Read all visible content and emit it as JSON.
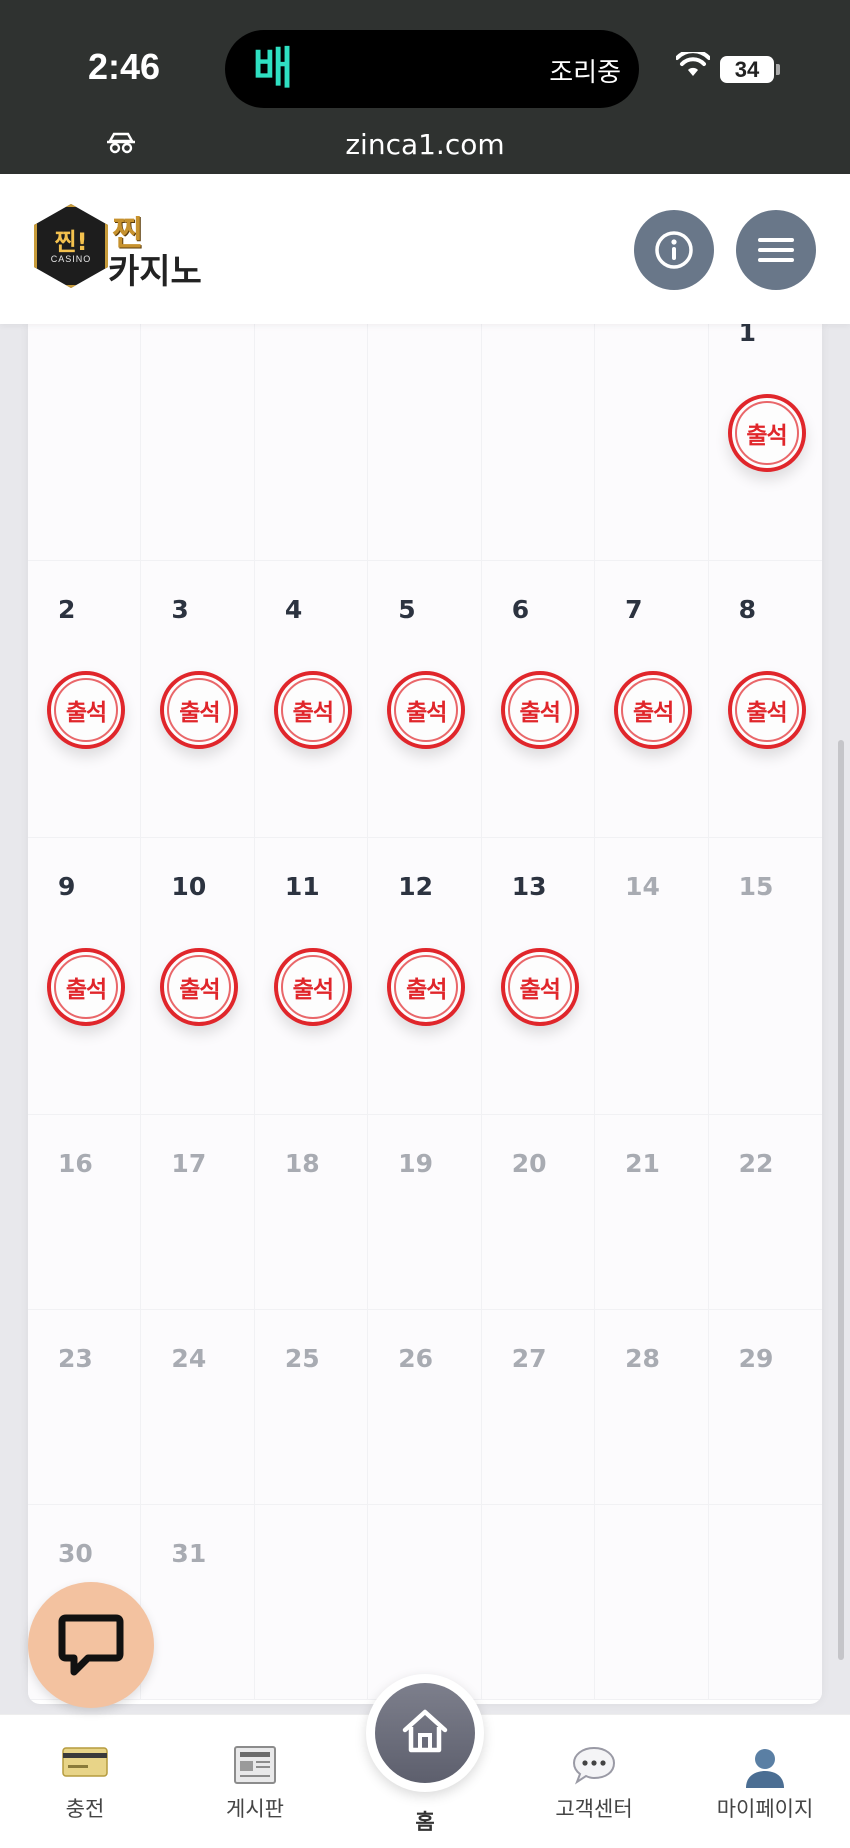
{
  "status_bar": {
    "time": "2:46",
    "island_text": "조리중",
    "island_app_icon": "baemin-app-icon",
    "battery": "34",
    "url": "zinca1.com"
  },
  "header": {
    "logo_badge": "찐!",
    "logo_badge_sub": "CASINO",
    "logo_word1": "찐",
    "logo_word2": "카지노",
    "info_icon": "info-icon",
    "menu_icon": "hamburger-menu-icon"
  },
  "calendar": {
    "stamp_label": "출석",
    "rows": [
      [
        {
          "d": "",
          "a": false,
          "f": false
        },
        {
          "d": "",
          "a": false,
          "f": false
        },
        {
          "d": "",
          "a": false,
          "f": false
        },
        {
          "d": "",
          "a": false,
          "f": false
        },
        {
          "d": "",
          "a": false,
          "f": false
        },
        {
          "d": "",
          "a": false,
          "f": false
        },
        {
          "d": "1",
          "a": true,
          "f": false
        }
      ],
      [
        {
          "d": "2",
          "a": true,
          "f": false
        },
        {
          "d": "3",
          "a": true,
          "f": false
        },
        {
          "d": "4",
          "a": true,
          "f": false
        },
        {
          "d": "5",
          "a": true,
          "f": false
        },
        {
          "d": "6",
          "a": true,
          "f": false
        },
        {
          "d": "7",
          "a": true,
          "f": false
        },
        {
          "d": "8",
          "a": true,
          "f": false
        }
      ],
      [
        {
          "d": "9",
          "a": true,
          "f": false
        },
        {
          "d": "10",
          "a": true,
          "f": false
        },
        {
          "d": "11",
          "a": true,
          "f": false
        },
        {
          "d": "12",
          "a": true,
          "f": false
        },
        {
          "d": "13",
          "a": true,
          "f": false
        },
        {
          "d": "14",
          "a": false,
          "f": true
        },
        {
          "d": "15",
          "a": false,
          "f": true
        }
      ],
      [
        {
          "d": "16",
          "a": false,
          "f": true
        },
        {
          "d": "17",
          "a": false,
          "f": true
        },
        {
          "d": "18",
          "a": false,
          "f": true
        },
        {
          "d": "19",
          "a": false,
          "f": true
        },
        {
          "d": "20",
          "a": false,
          "f": true
        },
        {
          "d": "21",
          "a": false,
          "f": true
        },
        {
          "d": "22",
          "a": false,
          "f": true
        }
      ],
      [
        {
          "d": "23",
          "a": false,
          "f": true
        },
        {
          "d": "24",
          "a": false,
          "f": true
        },
        {
          "d": "25",
          "a": false,
          "f": true
        },
        {
          "d": "26",
          "a": false,
          "f": true
        },
        {
          "d": "27",
          "a": false,
          "f": true
        },
        {
          "d": "28",
          "a": false,
          "f": true
        },
        {
          "d": "29",
          "a": false,
          "f": true
        }
      ],
      [
        {
          "d": "30",
          "a": false,
          "f": true
        },
        {
          "d": "31",
          "a": false,
          "f": true
        },
        {
          "d": "",
          "a": false,
          "f": false
        },
        {
          "d": "",
          "a": false,
          "f": false
        },
        {
          "d": "",
          "a": false,
          "f": false
        },
        {
          "d": "",
          "a": false,
          "f": false
        },
        {
          "d": "",
          "a": false,
          "f": false
        }
      ]
    ]
  },
  "bottom_nav": {
    "charge": "충전",
    "board": "게시판",
    "home": "홈",
    "support": "고객센터",
    "mypage": "마이페이지"
  },
  "colors": {
    "stamp_red": "#e0262b",
    "nav_button": "#697789",
    "chat_button": "#f3c2a0"
  }
}
